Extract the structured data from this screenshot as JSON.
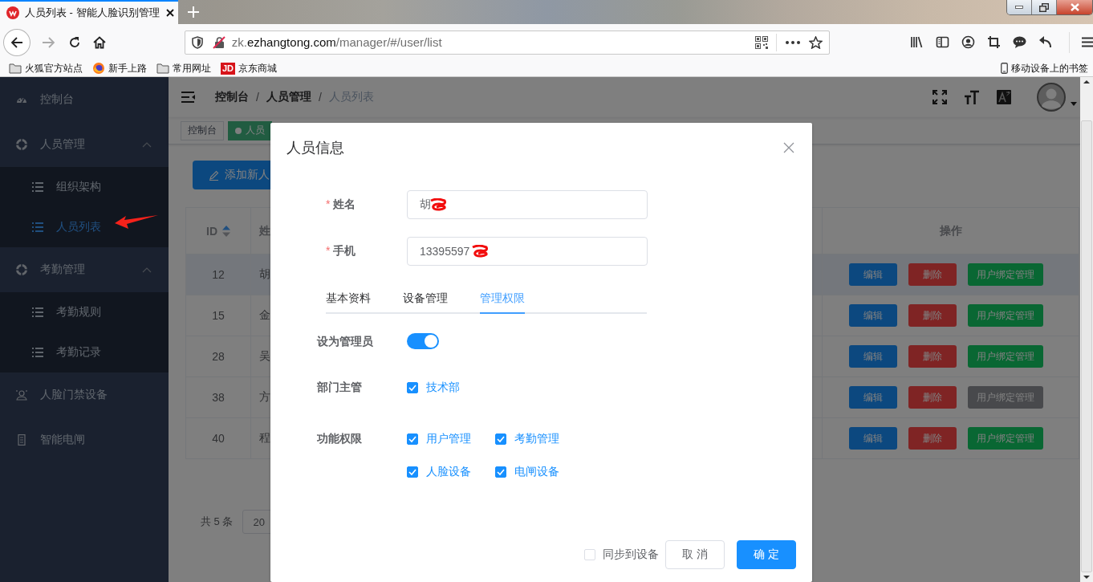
{
  "browser": {
    "tab_title": "人员列表 - 智能人脸识别管理",
    "url": {
      "subdomain": "zk.",
      "domain": "ezhangtong.com",
      "path": "/manager/#/user/list"
    },
    "bookmarks": [
      {
        "label": "火狐官方站点"
      },
      {
        "label": "新手上路"
      },
      {
        "label": "常用网址"
      },
      {
        "label": "京东商城",
        "badge": "JD"
      }
    ],
    "mobile_bookmarks": "移动设备上的书签"
  },
  "sidebar": {
    "items": [
      {
        "label": "控制台",
        "selected": false
      },
      {
        "label": "人员管理",
        "selected": false,
        "expanded": true,
        "children": [
          {
            "label": "组织架构",
            "selected": false
          },
          {
            "label": "人员列表",
            "selected": true
          }
        ]
      },
      {
        "label": "考勤管理",
        "selected": false,
        "expanded": true,
        "children": [
          {
            "label": "考勤规则",
            "selected": false
          },
          {
            "label": "考勤记录",
            "selected": false
          }
        ]
      },
      {
        "label": "人脸门禁设备",
        "selected": false
      },
      {
        "label": "智能电闸",
        "selected": false
      }
    ]
  },
  "header": {
    "breadcrumb": {
      "separator": "/",
      "items": [
        "控制台",
        "人员管理",
        "人员列表"
      ]
    }
  },
  "tags": [
    {
      "label": "控制台",
      "selected": false
    },
    {
      "label": "人员",
      "selected": true
    }
  ],
  "toolbar": {
    "add_button": "添加新人"
  },
  "table": {
    "columns": [
      {
        "label": "ID",
        "sortable": true
      },
      {
        "label": "姓"
      },
      {
        "label": "操作"
      }
    ],
    "rows": [
      {
        "id": "12",
        "name": "胡",
        "selected": true,
        "actions": [
          {
            "label": "编辑",
            "kind": "edit",
            "disabled": false
          },
          {
            "label": "删除",
            "kind": "delete",
            "disabled": false
          },
          {
            "label": "用户绑定管理",
            "kind": "bind",
            "disabled": false
          }
        ]
      },
      {
        "id": "15",
        "name": "金",
        "selected": false,
        "actions": [
          {
            "label": "编辑",
            "kind": "edit",
            "disabled": false
          },
          {
            "label": "删除",
            "kind": "delete",
            "disabled": false
          },
          {
            "label": "用户绑定管理",
            "kind": "bind",
            "disabled": false
          }
        ]
      },
      {
        "id": "28",
        "name": "吴",
        "selected": false,
        "actions": [
          {
            "label": "编辑",
            "kind": "edit",
            "disabled": false
          },
          {
            "label": "删除",
            "kind": "delete",
            "disabled": false
          },
          {
            "label": "用户绑定管理",
            "kind": "bind",
            "disabled": false
          }
        ]
      },
      {
        "id": "38",
        "name": "方",
        "selected": false,
        "actions": [
          {
            "label": "编辑",
            "kind": "edit",
            "disabled": false
          },
          {
            "label": "删除",
            "kind": "delete",
            "disabled": false
          },
          {
            "label": "用户绑定管理",
            "kind": "bind",
            "disabled": true
          }
        ]
      },
      {
        "id": "40",
        "name": "程",
        "selected": false,
        "actions": [
          {
            "label": "编辑",
            "kind": "edit",
            "disabled": false
          },
          {
            "label": "删除",
            "kind": "delete",
            "disabled": false
          },
          {
            "label": "用户绑定管理",
            "kind": "bind",
            "disabled": false
          }
        ]
      }
    ]
  },
  "pagination": {
    "total": "共 5 条",
    "page_size": "20"
  },
  "dialog": {
    "title": "人员信息",
    "fields": [
      {
        "marker": "*",
        "label": "姓名",
        "value": "胡"
      },
      {
        "marker": "*",
        "label": "手机",
        "value": "13395597"
      }
    ],
    "tabs": [
      {
        "label": "基本资料",
        "selected": false
      },
      {
        "label": "设备管理",
        "selected": false
      },
      {
        "label": "管理权限",
        "selected": true
      }
    ],
    "admin": {
      "label": "设为管理员",
      "on": true
    },
    "department": {
      "label": "部门主管",
      "options": [
        {
          "label": "技术部",
          "checked": true
        }
      ]
    },
    "permissions": {
      "label": "功能权限",
      "options": [
        {
          "label": "用户管理",
          "checked": true
        },
        {
          "label": "考勤管理",
          "checked": true
        },
        {
          "label": "人脸设备",
          "checked": true
        },
        {
          "label": "电闸设备",
          "checked": true
        }
      ]
    },
    "sync": {
      "label": "同步到设备",
      "checked": false
    },
    "buttons": [
      {
        "label": "取 消",
        "kind": "default"
      },
      {
        "label": "确 定",
        "kind": "primary"
      }
    ]
  }
}
